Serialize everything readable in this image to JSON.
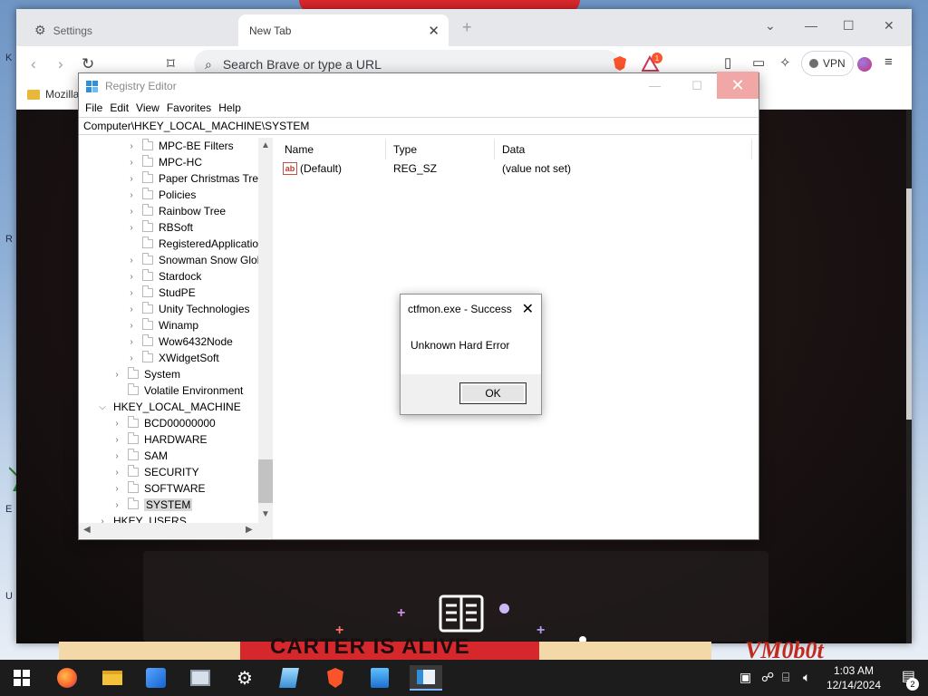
{
  "desktop": {
    "left_tags": [
      "K",
      "R",
      "E",
      "U"
    ]
  },
  "browser": {
    "tabs": [
      {
        "label": "Settings"
      },
      {
        "label": "New Tab"
      }
    ],
    "url_placeholder": "Search Brave or type a URL",
    "vpn_label": "VPN",
    "notification_count": "1",
    "bookmark": "Mozilla"
  },
  "page": {
    "cartoon_text": "CARTER IS ALIVE",
    "watermark": "VM0b0t"
  },
  "regedit": {
    "title": "Registry Editor",
    "menu": [
      "File",
      "Edit",
      "View",
      "Favorites",
      "Help"
    ],
    "address": "Computer\\HKEY_LOCAL_MACHINE\\SYSTEM",
    "tree": [
      {
        "label": "MPC-BE Filters",
        "level": 2,
        "expand": ">"
      },
      {
        "label": "MPC-HC",
        "level": 2,
        "expand": ">"
      },
      {
        "label": "Paper Christmas Tree",
        "level": 2,
        "expand": ">"
      },
      {
        "label": "Policies",
        "level": 2,
        "expand": ">"
      },
      {
        "label": "Rainbow Tree",
        "level": 2,
        "expand": ">"
      },
      {
        "label": "RBSoft",
        "level": 2,
        "expand": ">"
      },
      {
        "label": "RegisteredApplications",
        "level": 2,
        "expand": ""
      },
      {
        "label": "Snowman Snow Globe",
        "level": 2,
        "expand": ">"
      },
      {
        "label": "Stardock",
        "level": 2,
        "expand": ">"
      },
      {
        "label": "StudPE",
        "level": 2,
        "expand": ">"
      },
      {
        "label": "Unity Technologies",
        "level": 2,
        "expand": ">"
      },
      {
        "label": "Winamp",
        "level": 2,
        "expand": ">"
      },
      {
        "label": "Wow6432Node",
        "level": 2,
        "expand": ">"
      },
      {
        "label": "XWidgetSoft",
        "level": 2,
        "expand": ">"
      },
      {
        "label": "System",
        "level": 1,
        "expand": ">"
      },
      {
        "label": "Volatile Environment",
        "level": 1,
        "expand": ""
      },
      {
        "label": "HKEY_LOCAL_MACHINE",
        "level": 0,
        "expand": "v"
      },
      {
        "label": "BCD00000000",
        "level": 1,
        "expand": ">"
      },
      {
        "label": "HARDWARE",
        "level": 1,
        "expand": ">"
      },
      {
        "label": "SAM",
        "level": 1,
        "expand": ">"
      },
      {
        "label": "SECURITY",
        "level": 1,
        "expand": ">"
      },
      {
        "label": "SOFTWARE",
        "level": 1,
        "expand": ">"
      },
      {
        "label": "SYSTEM",
        "level": 1,
        "expand": ">",
        "selected": true
      },
      {
        "label": "HKEY_USERS",
        "level": 0,
        "expand": ">"
      }
    ],
    "columns": [
      "Name",
      "Type",
      "Data"
    ],
    "values": [
      {
        "name": "(Default)",
        "type": "REG_SZ",
        "data": "(value not set)"
      }
    ]
  },
  "dialog": {
    "title": "ctfmon.exe - Success",
    "message": "Unknown Hard Error",
    "ok": "OK"
  },
  "taskbar": {
    "time": "1:03 AM",
    "date": "12/14/2024",
    "notification_badge": "2",
    "pinned": [
      "start",
      "firefox",
      "file-explorer",
      "app-store",
      "photos",
      "settings",
      "notepad",
      "brave",
      "installer",
      "registry-editor"
    ]
  },
  "colors": {
    "taskbar": "#1c1c1c",
    "regedit_close": "#f1a7a5",
    "brave_orange": "#fb542b"
  }
}
